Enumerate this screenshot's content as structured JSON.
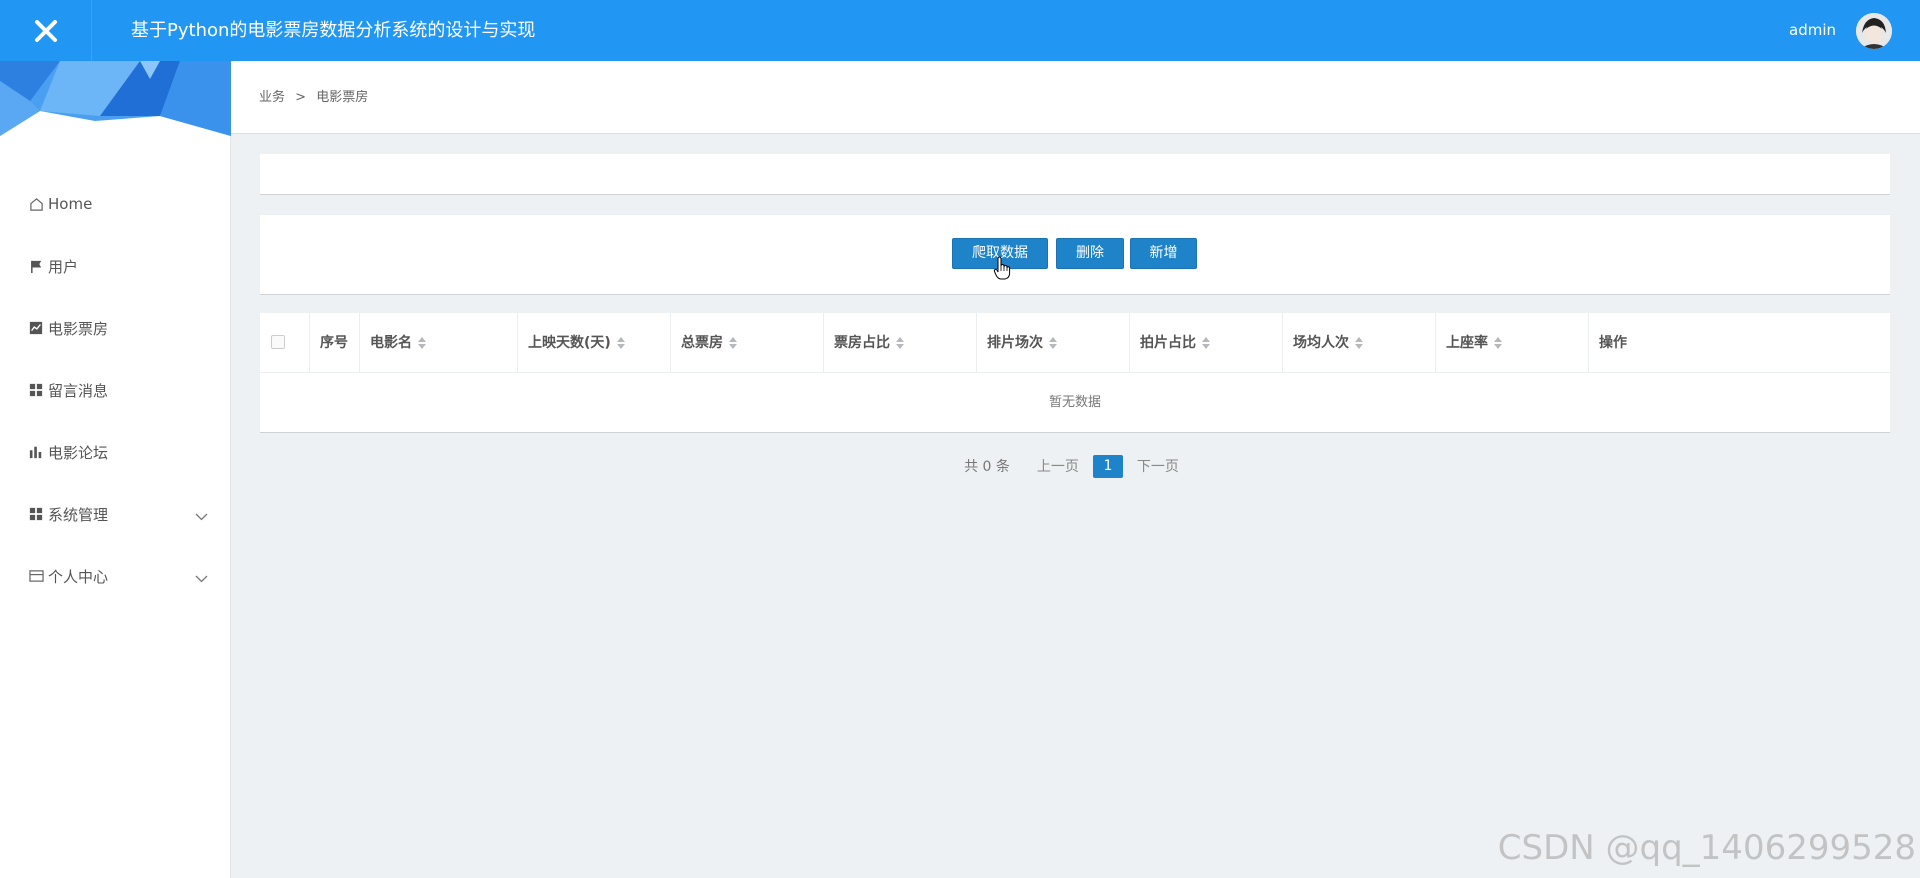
{
  "header": {
    "title": "基于Python的电影票房数据分析系统的设计与实现",
    "username": "admin",
    "accent_color": "#2196f3"
  },
  "sidebar": {
    "items": [
      {
        "label": "Home",
        "icon": "home-icon"
      },
      {
        "label": "用户",
        "icon": "flag-icon"
      },
      {
        "label": "电影票房",
        "icon": "chart-icon"
      },
      {
        "label": "留言消息",
        "icon": "grid-icon"
      },
      {
        "label": "电影论坛",
        "icon": "bar-chart-icon"
      },
      {
        "label": "系统管理",
        "icon": "grid-icon",
        "expandable": true
      },
      {
        "label": "个人中心",
        "icon": "wallet-icon",
        "expandable": true
      }
    ]
  },
  "breadcrumb": {
    "parent": "业务",
    "separator": ">",
    "current": "电影票房"
  },
  "actions": {
    "crawl": "爬取数据",
    "delete": "删除",
    "add": "新增"
  },
  "table": {
    "columns": [
      "序号",
      "电影名",
      "上映天数(天)",
      "总票房",
      "票房占比",
      "排片场次",
      "拍片占比",
      "场均人次",
      "上座率",
      "操作"
    ],
    "empty_text": "暂无数据"
  },
  "pagination": {
    "total": "共 0 条",
    "prev": "上一页",
    "current_page": "1",
    "next": "下一页"
  },
  "watermark": "CSDN @qq_1406299528"
}
